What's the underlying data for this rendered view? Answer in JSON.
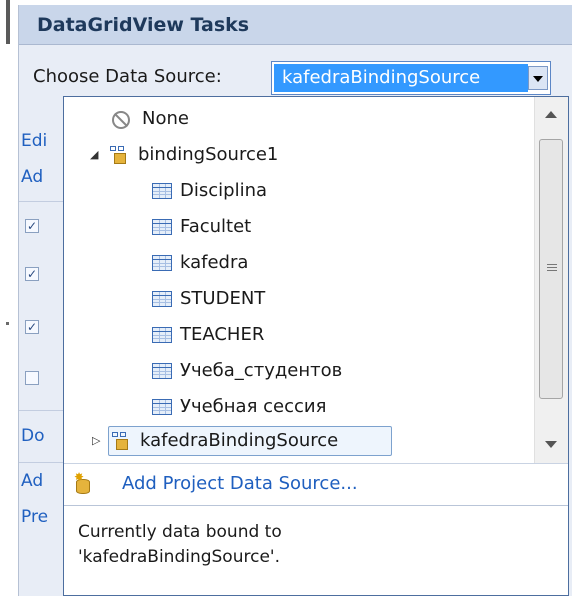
{
  "panel": {
    "title": "DataGridView Tasks",
    "choose_label": "Choose Data Source:",
    "selected_value": "kafedraBindingSource"
  },
  "background_items": {
    "edit": "Edi",
    "add": "Ad",
    "dock": "Do",
    "add2": "Ad",
    "preview": "Pre"
  },
  "tree": {
    "none": "None",
    "binding_source1": "bindingSource1",
    "tables": [
      "Disciplina",
      "Facultet",
      "kafedra",
      "STUDENT",
      "TEACHER",
      "Учеба_студентов",
      "Учебная сессия"
    ],
    "kafedra_binding_source": "kafedraBindingSource"
  },
  "add_project_ds": "Add Project Data Source...",
  "status_line1": "Currently data bound to",
  "status_line2": "'kafedraBindingSource'."
}
